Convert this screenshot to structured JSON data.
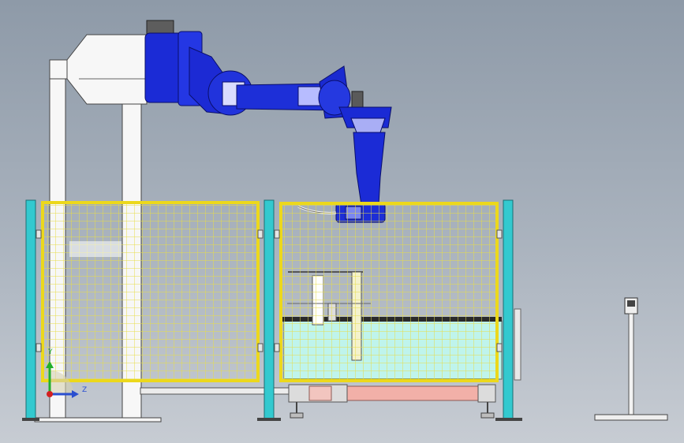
{
  "triad": {
    "y_label": "Y",
    "z_label": "Z"
  },
  "colors": {
    "robot": "#1a2ad8",
    "fence_frame": "#ecd81c",
    "fence_mesh": "#e8df4a",
    "post": "#33c9cf",
    "tank": "#bff4ec",
    "rail": "#f2b0a8",
    "structure": "#ffffff"
  }
}
